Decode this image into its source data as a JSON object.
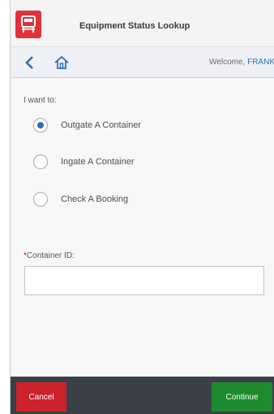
{
  "header": {
    "title": "Equipment Status Lookup",
    "logo_icon": "truck-icon",
    "logo_color": "#e0313a"
  },
  "nav": {
    "back_icon": "chevron-left-icon",
    "home_icon": "home-icon",
    "welcome_prefix": "Welcome, ",
    "user_name": "FRANK"
  },
  "form": {
    "prompt": "I want to:",
    "options": [
      {
        "label": "Outgate A Container",
        "selected": true
      },
      {
        "label": "Ingate A Container",
        "selected": false
      },
      {
        "label": "Check A Booking",
        "selected": false
      }
    ],
    "container_id": {
      "required_marker": "*",
      "label": "Container ID:",
      "value": "",
      "placeholder": ""
    }
  },
  "footer": {
    "cancel_label": "Cancel",
    "continue_label": "Continue",
    "cancel_color": "#cc2229",
    "continue_color": "#1e8a2e"
  },
  "colors": {
    "accent": "#2f6fb7",
    "footer_bg": "#3b4048"
  }
}
